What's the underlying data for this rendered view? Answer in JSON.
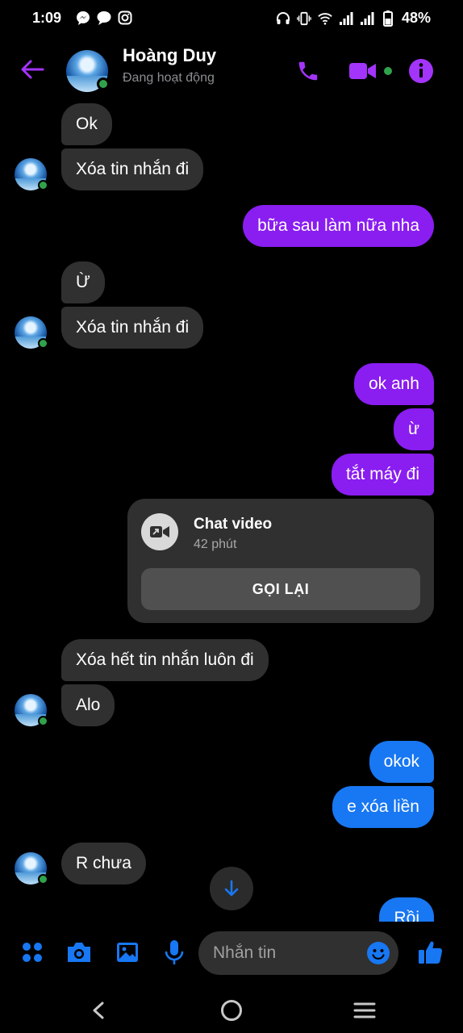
{
  "status_bar": {
    "time": "1:09",
    "battery": "48%",
    "left_icons": [
      "messenger-icon",
      "chat-bubble-icon",
      "instagram-icon"
    ],
    "right_icons": [
      "headphones-icon",
      "vibrate-icon",
      "wifi-icon",
      "signal-icon",
      "signal-icon",
      "battery-icon"
    ]
  },
  "header": {
    "name": "Hoàng Duy",
    "status": "Đang hoạt động",
    "accent_color": "#a334fa"
  },
  "messages": [
    {
      "side": "in",
      "text": "Ok"
    },
    {
      "side": "in",
      "text": "Xóa tin nhắn đi"
    },
    {
      "side": "out",
      "text": "bữa sau làm nữa nha"
    },
    {
      "side": "in",
      "text": "Ừ"
    },
    {
      "side": "in",
      "text": "Xóa tin nhắn đi"
    },
    {
      "side": "out",
      "text": "ok anh"
    },
    {
      "side": "out",
      "text": "ừ"
    },
    {
      "side": "out",
      "text": "tắt máy đi"
    },
    {
      "side": "in",
      "text": "Xóa hết tin nhắn luôn đi"
    },
    {
      "side": "in",
      "text": "Alo"
    },
    {
      "side": "out",
      "text": "okok"
    },
    {
      "side": "out",
      "text": "e xóa liền"
    },
    {
      "side": "in",
      "text": "R chưa"
    },
    {
      "side": "out",
      "text": "Rồi"
    }
  ],
  "video_call": {
    "title": "Chat video",
    "duration": "42 phút",
    "button_label": "GỌI LẠI"
  },
  "composer": {
    "placeholder": "Nhắn tin",
    "icons": [
      "menu-grid-icon",
      "camera-icon",
      "gallery-icon",
      "microphone-icon",
      "emoji-icon",
      "thumbs-up-icon"
    ]
  },
  "colors": {
    "incoming_bubble": "#303030",
    "outgoing_purple": "#8a1df0",
    "outgoing_blue": "#1877f2",
    "online": "#31a24c"
  }
}
